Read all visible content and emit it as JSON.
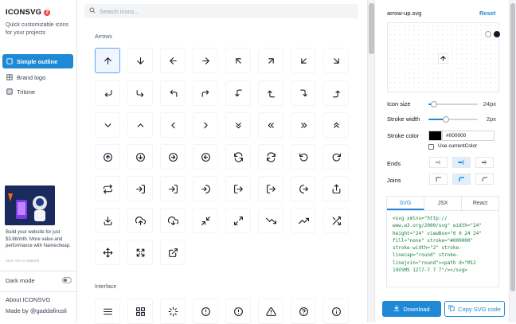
{
  "sidebar": {
    "logo": "ICONSVG",
    "logo_badge": "2",
    "tagline": "Quick customizable icons for your projects",
    "nav": [
      {
        "label": "Simple outline",
        "active": true
      },
      {
        "label": "Brand logo",
        "active": false
      },
      {
        "label": "Tritone",
        "active": false
      }
    ],
    "ad_text": "Build your website for just $3.88/mth. More value and performance with Namecheap.",
    "ad_via": "ADS VIA CARBON",
    "dark_mode_label": "Dark mode",
    "about_label": "About ICONSVG",
    "made_by": "Made by @gaddafirusli"
  },
  "main": {
    "search_placeholder": "Search icons...",
    "sections": [
      {
        "title": "Arrows"
      },
      {
        "title": "Interface"
      }
    ]
  },
  "panel": {
    "filename": "arrow-up.svg",
    "reset_label": "Reset",
    "icon_size_label": "Icon size",
    "icon_size_value": "24px",
    "stroke_width_label": "Stroke width",
    "stroke_width_value": "2px",
    "stroke_color_label": "Stroke color",
    "stroke_color_value": "#000000",
    "use_current_color_label": "Use currentColor",
    "ends_label": "Ends",
    "joins_label": "Joins",
    "tabs": [
      "SVG",
      "JSX",
      "React"
    ],
    "active_tab": "SVG",
    "code": "<svg xmlns=\"http://\nwww.w3.org/2000/svg\" width=\"24\"\nheight=\"24\" viewBox=\"0 0 24 24\"\nfill=\"none\" stroke=\"#000000\"\nstroke-width=\"2\" stroke-\nlinecap=\"round\" stroke-\nlinejoin=\"round\"><path d=\"M12\n19V5M5 12l7-7 7 7\"/></svg>",
    "download_label": "Download",
    "copy_label": "Copy SVG code"
  },
  "colors": {
    "accent": "#1e8ad6",
    "selected_border": "#60a5fa"
  }
}
